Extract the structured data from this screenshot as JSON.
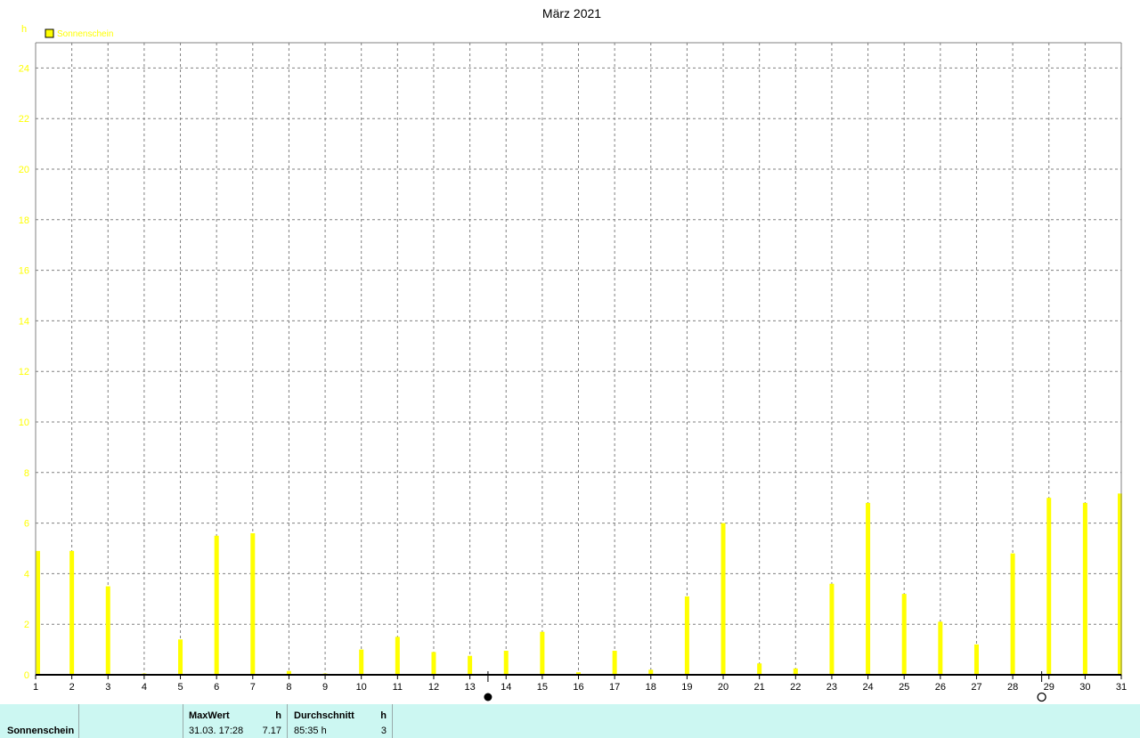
{
  "colors": {
    "bar": "#ffff00",
    "grid": "#808080",
    "axis": "#000000",
    "footer_bg": "#ccf7f2"
  },
  "chart_data": {
    "type": "bar",
    "title": "März 2021",
    "ylabel": "h",
    "ylim": [
      0,
      25
    ],
    "yticks": [
      0,
      2,
      4,
      6,
      8,
      10,
      12,
      14,
      16,
      18,
      20,
      22,
      24
    ],
    "grid": true,
    "legend_position": "top-left",
    "series": [
      {
        "name": "Sonnenschein",
        "color": "#ffff00",
        "values": [
          4.9,
          4.9,
          3.5,
          0.05,
          1.4,
          5.5,
          5.6,
          0.15,
          0.05,
          1.0,
          1.5,
          0.9,
          0.75,
          0.95,
          1.7,
          0.1,
          0.95,
          0.2,
          3.1,
          6.0,
          0.45,
          0.25,
          3.6,
          6.8,
          3.2,
          2.1,
          1.2,
          4.8,
          7.0,
          6.8,
          7.17
        ]
      }
    ],
    "categories": [
      "1",
      "2",
      "3",
      "4",
      "5",
      "6",
      "7",
      "8",
      "9",
      "10",
      "11",
      "12",
      "13",
      "14",
      "15",
      "16",
      "17",
      "18",
      "19",
      "20",
      "21",
      "22",
      "23",
      "24",
      "25",
      "26",
      "27",
      "28",
      "29",
      "30",
      "31"
    ],
    "moon_phases": [
      {
        "day": 13.5,
        "phase": "new-moon"
      },
      {
        "day": 28.8,
        "phase": "full-moon"
      }
    ]
  },
  "stats": {
    "series_label": "Sonnenschein",
    "max_header": "MaxWert",
    "max_unit": "h",
    "max_time": "31.03.  17:28",
    "max_value": "7.17",
    "avg_header": "Durchschnitt",
    "avg_unit": "h",
    "avg_value": "85:35 h",
    "avg_count": "3"
  }
}
